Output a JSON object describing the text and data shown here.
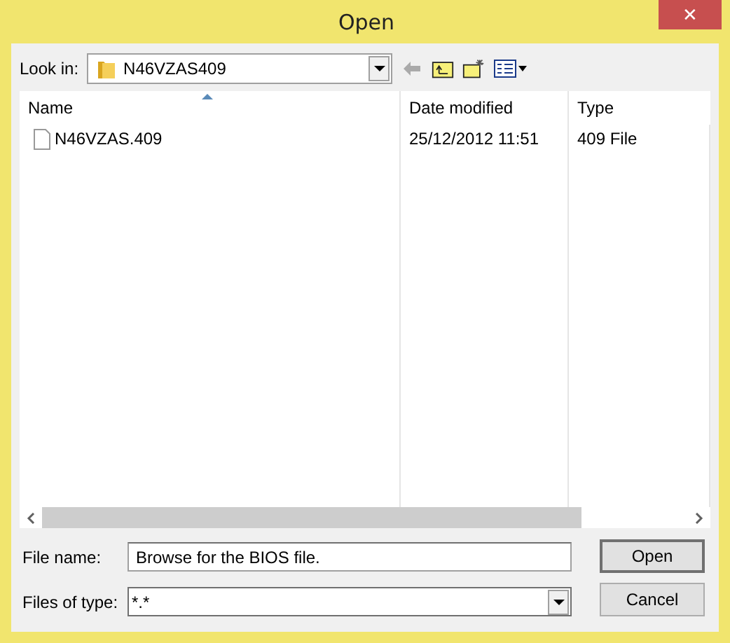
{
  "window": {
    "title": "Open",
    "close": "✕"
  },
  "look_in": {
    "label": "Look in:",
    "value": "N46VZAS409"
  },
  "table": {
    "columns": [
      {
        "label": "Name",
        "sorted": true
      },
      {
        "label": "Date modified",
        "sorted": false
      },
      {
        "label": "Type",
        "sorted": false
      }
    ],
    "rows": [
      {
        "cells": [
          "N46VZAS.409",
          "25/12/2012 11:51",
          "409 File"
        ]
      }
    ]
  },
  "file_name": {
    "label": "File name:",
    "value": "Browse for the BIOS file."
  },
  "file_type": {
    "label": "Files of type:",
    "value": "*.*"
  },
  "buttons": [
    "Open",
    "Cancel"
  ]
}
